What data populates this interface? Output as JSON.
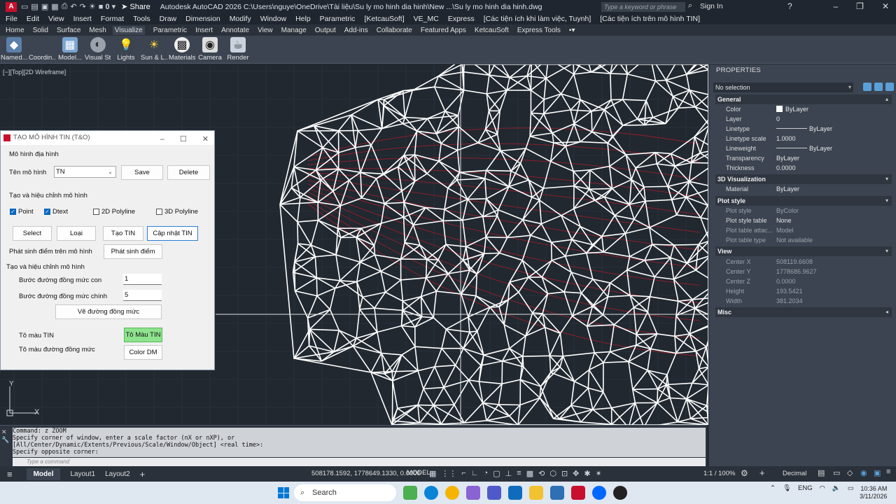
{
  "app": {
    "logo": "A",
    "title": "Autodesk AutoCAD 2026   C:\\Users\\nguye\\OneDrive\\Tài liệu\\Su ly mo hinh dia hinh\\New ...\\Su ly mo hinh dia hinh.dwg",
    "share_label": "Share",
    "layer_value": "0",
    "search_placeholder": "Type a keyword or phrase",
    "signin": "Sign In"
  },
  "menu": [
    "File",
    "Edit",
    "View",
    "Insert",
    "Format",
    "Tools",
    "Draw",
    "Dimension",
    "Modify",
    "Window",
    "Help",
    "Parametric",
    "[KetcauSoft]",
    "VE_MC",
    "Express",
    "[Các tiện ích khi làm việc, Tuynh]",
    "[Các tiện ích trên mô hình TIN]"
  ],
  "ribbon_tabs": [
    "Home",
    "Solid",
    "Surface",
    "Mesh",
    "Visualize",
    "Parametric",
    "Insert",
    "Annotate",
    "View",
    "Manage",
    "Output",
    "Add-ins",
    "Collaborate",
    "Featured Apps",
    "KetcauSoft",
    "Express Tools"
  ],
  "ribbon_active_tab": "Visualize",
  "ribbon_buttons": [
    {
      "label": "Named...",
      "icon": "named-views-icon"
    },
    {
      "label": "Coordin...",
      "icon": "coordinates-icon"
    },
    {
      "label": "Model...",
      "icon": "model-viewports-icon"
    },
    {
      "label": "Visual St...",
      "icon": "visual-styles-icon"
    },
    {
      "label": "Lights",
      "icon": "lights-icon"
    },
    {
      "label": "Sun & L...",
      "icon": "sun-icon"
    },
    {
      "label": "Materials",
      "icon": "materials-icon"
    },
    {
      "label": "Camera",
      "icon": "camera-icon"
    },
    {
      "label": "Render",
      "icon": "render-icon"
    }
  ],
  "viewport": {
    "label": "[−][Top][2D Wireframe]",
    "ucs_x": "X",
    "ucs_y": "Y"
  },
  "dialog": {
    "title": "TẠO MÔ HÌNH TIN (T&O)",
    "section_model": "Mô hình địa hình",
    "name_label": "Tên mô hình",
    "name_value": "TN",
    "save": "Save",
    "delete": "Delete",
    "section_edit": "Tạo và hiệu chỉnh mô hình",
    "chk_point": "Point",
    "chk_dtext": "Dtext",
    "chk_2dpoly": "2D Polyline",
    "chk_3dpoly": "3D Polyline",
    "btn_select": "Select",
    "btn_loai": "Loại",
    "btn_tao_tin": "Tạo TIN",
    "btn_cap_nhat": "Cập nhật TIN",
    "gen_points_label": "Phát sinh điểm trên mô hình",
    "btn_gen_points": "Phát sinh điểm",
    "section_contour": "Tạo và hiệu chỉnh mô hình",
    "minor_label": "Bước đường đồng mức con",
    "minor_value": "1",
    "major_label": "Bước đường đồng mức chính",
    "major_value": "5",
    "btn_draw_contour": "Vẽ đường đồng mức",
    "color_tin_label": "Tô màu TIN",
    "btn_color_tin": "Tô Màu TIN",
    "color_contour_label": "Tô màu đường đồng mức",
    "btn_color_dm": "Color DM"
  },
  "command": {
    "lines": [
      "Command: z ZOOM",
      "Specify corner of window, enter a scale factor (nX or nXP), or",
      "[All/Center/Dynamic/Extents/Previous/Scale/Window/Object] <real time>:",
      "Specify opposite corner:"
    ],
    "placeholder": "Type a command"
  },
  "status": {
    "tabs": [
      "Model",
      "Layout1",
      "Layout2"
    ],
    "add": "+",
    "coords": "508178.1592, 1778649.1330, 0.0000",
    "model": "MODEL",
    "scale": "1:1 / 100%",
    "units": "Decimal"
  },
  "properties": {
    "header": "PROPERTIES",
    "selection": "No selection",
    "sections": {
      "general": "General",
      "viz3d": "3D Visualization",
      "plot": "Plot style",
      "view": "View",
      "misc": "Misc"
    },
    "general": [
      {
        "k": "Color",
        "v": "ByLayer"
      },
      {
        "k": "Layer",
        "v": "0"
      },
      {
        "k": "Linetype",
        "v": "ByLayer"
      },
      {
        "k": "Linetype scale",
        "v": "1.0000"
      },
      {
        "k": "Lineweight",
        "v": "ByLayer"
      },
      {
        "k": "Transparency",
        "v": "ByLayer"
      },
      {
        "k": "Thickness",
        "v": "0.0000"
      }
    ],
    "viz3d": [
      {
        "k": "Material",
        "v": "ByLayer"
      }
    ],
    "plot": [
      {
        "k": "Plot style",
        "v": "ByColor"
      },
      {
        "k": "Plot style table",
        "v": "None"
      },
      {
        "k": "Plot table attac...",
        "v": "Model"
      },
      {
        "k": "Plot table type",
        "v": "Not available"
      }
    ],
    "view": [
      {
        "k": "Center X",
        "v": "508119.6608"
      },
      {
        "k": "Center Y",
        "v": "1778686.9627"
      },
      {
        "k": "Center Z",
        "v": "0.0000"
      },
      {
        "k": "Height",
        "v": "193.5421"
      },
      {
        "k": "Width",
        "v": "381.2034"
      }
    ]
  },
  "taskbar": {
    "search": "Search",
    "lang": "ENG",
    "time": "10:36 AM",
    "date": "3/11/2026"
  },
  "colors": {
    "accent": "#0078d4",
    "autocad_red": "#c8102e",
    "mesh": "#ffffff",
    "contour": "#8a1f2a"
  }
}
